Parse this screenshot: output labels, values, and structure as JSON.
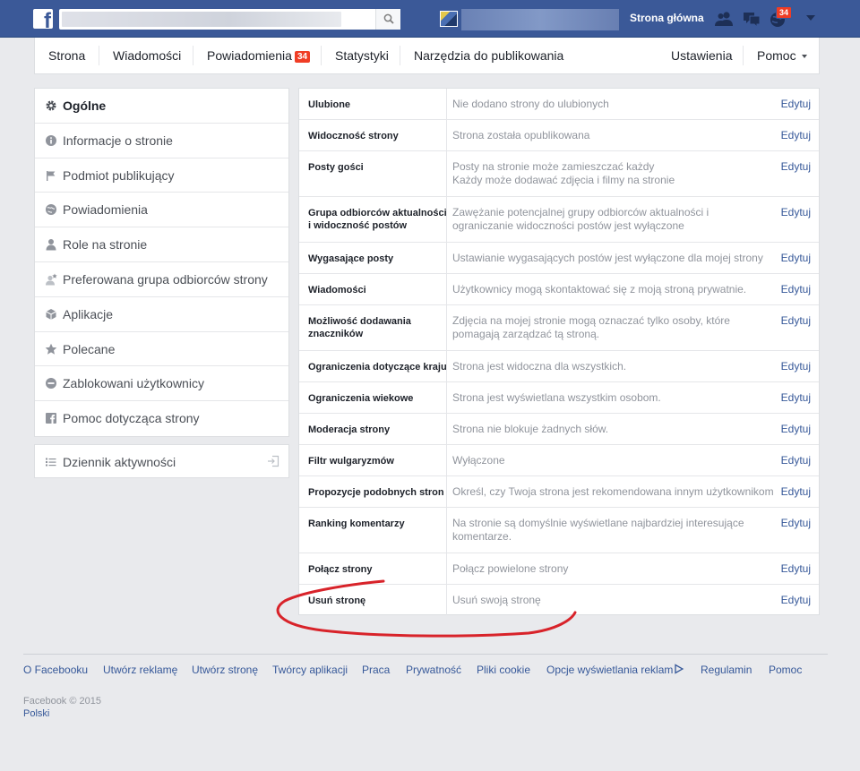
{
  "topbar": {
    "logo_letter": "f",
    "home_label": "Strona główna",
    "notif_count": "34"
  },
  "page_nav": {
    "items": [
      {
        "label": "Strona"
      },
      {
        "label": "Wiadomości"
      },
      {
        "label": "Powiadomienia",
        "badge": "34"
      },
      {
        "label": "Statystyki"
      },
      {
        "label": "Narzędzia do publikowania"
      }
    ],
    "settings_label": "Ustawienia",
    "help_label": "Pomoc"
  },
  "left_menu": {
    "items": [
      {
        "label": "Ogólne",
        "icon": "gear-icon"
      },
      {
        "label": "Informacje o stronie",
        "icon": "info-icon"
      },
      {
        "label": "Podmiot publikujący",
        "icon": "flag-icon"
      },
      {
        "label": "Powiadomienia",
        "icon": "globe-icon"
      },
      {
        "label": "Role na stronie",
        "icon": "person-icon"
      },
      {
        "label": "Preferowana grupa odbiorców strony",
        "icon": "person-star-icon"
      },
      {
        "label": "Aplikacje",
        "icon": "cube-icon"
      },
      {
        "label": "Polecane",
        "icon": "star-icon"
      },
      {
        "label": "Zablokowani użytkownicy",
        "icon": "minus-circle-icon"
      },
      {
        "label": "Pomoc dotycząca strony",
        "icon": "facebook-icon"
      }
    ],
    "activity_log_label": "Dziennik aktywności"
  },
  "settings": {
    "edit_label": "Edytuj",
    "rows": [
      {
        "label": "Ulubione",
        "value": "Nie dodano strony do ulubionych"
      },
      {
        "label": "Widoczność strony",
        "value": "Strona została opublikowana"
      },
      {
        "label": "Posty gości",
        "value": "Posty na stronie może zamieszczać każdy\nKażdy może dodawać zdjęcia i filmy na stronie"
      },
      {
        "label": "Grupa odbiorców aktualności i widoczność postów",
        "value": "Zawężanie potencjalnej grupy odbiorców aktualności i ograniczanie widoczności postów jest wyłączone"
      },
      {
        "label": "Wygasające posty",
        "value": "Ustawianie wygasających postów jest wyłączone dla mojej strony"
      },
      {
        "label": "Wiadomości",
        "value": "Użytkownicy mogą skontaktować się z moją stroną prywatnie."
      },
      {
        "label": "Możliwość dodawania znaczników",
        "value": "Zdjęcia na mojej stronie mogą oznaczać tylko osoby, które pomagają zarządzać tą stroną."
      },
      {
        "label": "Ograniczenia dotyczące kraju",
        "value": "Strona jest widoczna dla wszystkich."
      },
      {
        "label": "Ograniczenia wiekowe",
        "value": "Strona jest wyświetlana wszystkim osobom."
      },
      {
        "label": "Moderacja strony",
        "value": "Strona nie blokuje żadnych słów."
      },
      {
        "label": "Filtr wulgaryzmów",
        "value": "Wyłączone"
      },
      {
        "label": "Propozycje podobnych stron",
        "value": "Określ, czy Twoja strona jest rekomendowana innym użytkownikom"
      },
      {
        "label": "Ranking komentarzy",
        "value": "Na stronie są domyślnie wyświetlane najbardziej interesujące komentarze."
      },
      {
        "label": "Połącz strony",
        "value": "Połącz powielone strony"
      },
      {
        "label": "Usuń stronę",
        "value": "Usuń swoją stronę"
      }
    ]
  },
  "footer": {
    "links": [
      "O Facebooku",
      "Utwórz reklamę",
      "Utwórz stronę",
      "Twórcy aplikacji",
      "Praca",
      "Prywatność",
      "Pliki cookie",
      "Opcje wyświetlania reklam",
      "Regulamin",
      "Pomoc"
    ],
    "copyright": "Facebook © 2015",
    "language": "Polski"
  },
  "colors": {
    "brand_blue": "#3b5998",
    "link_blue": "#365899",
    "badge_red": "#f03d25",
    "annotation_red": "#d8232a"
  }
}
